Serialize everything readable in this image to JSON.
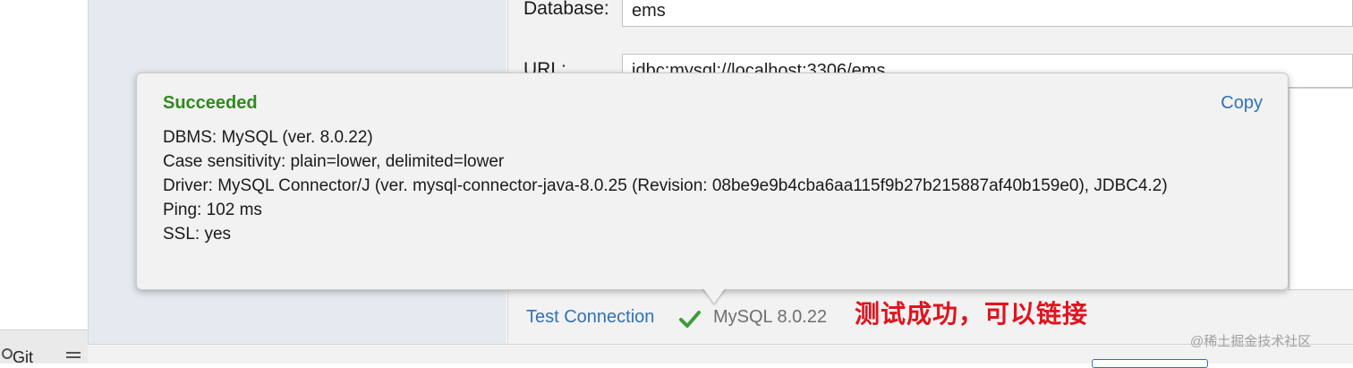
{
  "form": {
    "database_label": "Database:",
    "database_value": "ems",
    "url_label": "URL:",
    "url_value": "jdbc:mysql://localhost:3306/ems"
  },
  "popup": {
    "title": "Succeeded",
    "copy_label": "Copy",
    "lines": [
      "DBMS: MySQL (ver. 8.0.22)",
      "Case sensitivity: plain=lower, delimited=lower",
      "Driver: MySQL Connector/J (ver. mysql-connector-java-8.0.25 (Revision: 08be9e9b4cba6aa115f9b27b215887af40b159e0), JDBC4.2)",
      "Ping: 102 ms",
      "SSL: yes"
    ]
  },
  "footer": {
    "test_connection_label": "Test Connection",
    "status_icon": "check-icon",
    "server_version": "MySQL 8.0.22",
    "annotation": "测试成功，可以链接",
    "watermark": "@稀土掘金技术社区"
  },
  "tool_window": {
    "git_label": "Git"
  },
  "colors": {
    "success": "#2e8b1e",
    "link": "#2f72b8",
    "annotation": "#e0141e"
  }
}
